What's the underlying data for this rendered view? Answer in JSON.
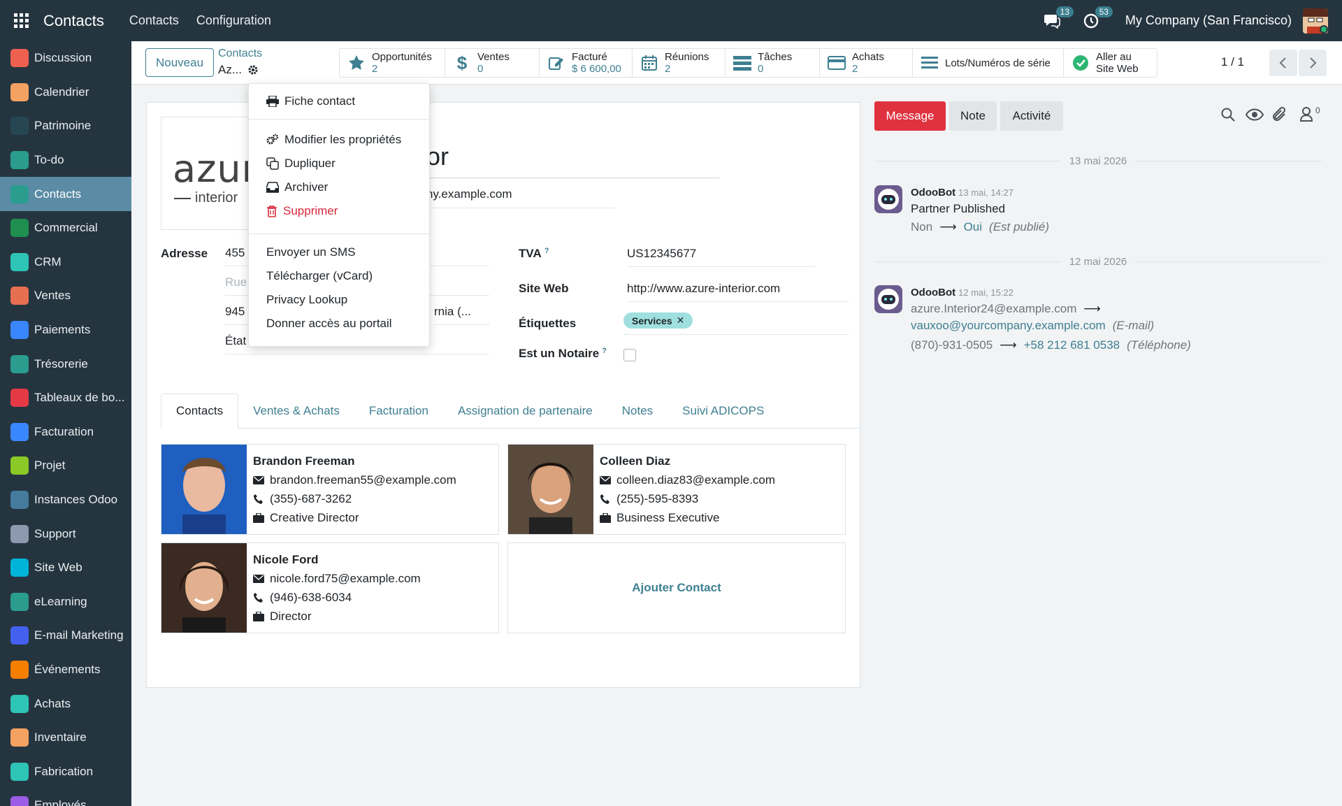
{
  "topbar": {
    "app_name": "Contacts",
    "menus": [
      "Contacts",
      "Configuration"
    ],
    "messages_count": "13",
    "activities_count": "53",
    "company": "My Company (San Francisco)"
  },
  "sidebar": {
    "items": [
      {
        "label": "Discussion",
        "icon": "discussion-icon",
        "color": "#f06050"
      },
      {
        "label": "Calendrier",
        "icon": "calendar-icon",
        "color": "#f4a261"
      },
      {
        "label": "Patrimoine",
        "icon": "assets-icon",
        "color": "#264653"
      },
      {
        "label": "To-do",
        "icon": "todo-icon",
        "color": "#2a9d8f"
      },
      {
        "label": "Contacts",
        "icon": "contacts-icon",
        "color": "#2a9d8f"
      },
      {
        "label": "Commercial",
        "icon": "commercial-icon",
        "color": "#1e8f4e"
      },
      {
        "label": "CRM",
        "icon": "crm-icon",
        "color": "#2ec4b6"
      },
      {
        "label": "Ventes",
        "icon": "sales-icon",
        "color": "#e76f51"
      },
      {
        "label": "Paiements",
        "icon": "payments-icon",
        "color": "#3a86ff"
      },
      {
        "label": "Trésorerie",
        "icon": "treasury-icon",
        "color": "#2a9d8f"
      },
      {
        "label": "Tableaux de bo...",
        "icon": "dashboards-icon",
        "color": "#e63946"
      },
      {
        "label": "Facturation",
        "icon": "invoicing-icon",
        "color": "#3a86ff"
      },
      {
        "label": "Projet",
        "icon": "project-icon",
        "color": "#8ac926"
      },
      {
        "label": "Instances Odoo",
        "icon": "instances-icon",
        "color": "#457b9d"
      },
      {
        "label": "Support",
        "icon": "support-icon",
        "color": "#8d99ae"
      },
      {
        "label": "Site Web",
        "icon": "website-icon",
        "color": "#00b4d8"
      },
      {
        "label": "eLearning",
        "icon": "elearning-icon",
        "color": "#2a9d8f"
      },
      {
        "label": "E-mail Marketing",
        "icon": "email-marketing-icon",
        "color": "#4361ee"
      },
      {
        "label": "Événements",
        "icon": "events-icon",
        "color": "#f77f00"
      },
      {
        "label": "Achats",
        "icon": "purchase-icon",
        "color": "#2ec4b6"
      },
      {
        "label": "Inventaire",
        "icon": "inventory-icon",
        "color": "#f4a261"
      },
      {
        "label": "Fabrication",
        "icon": "manufacturing-icon",
        "color": "#2ec4b6"
      },
      {
        "label": "Employés",
        "icon": "employees-icon",
        "color": "#9b5de5"
      }
    ]
  },
  "control": {
    "new_label": "Nouveau",
    "breadcrumb": "Contacts",
    "record_short": "Az...",
    "pager": "1 / 1"
  },
  "smart_buttons": [
    {
      "label": "Opportunités",
      "value": "2",
      "icon": "star-icon"
    },
    {
      "label": "Ventes",
      "value": "0",
      "icon": "dollar-icon"
    },
    {
      "label": "Facturé",
      "value": "$ 6 600,00",
      "icon": "edit-invoice-icon"
    },
    {
      "label": "Réunions",
      "value": "2",
      "icon": "calendar-icon"
    },
    {
      "label": "Tâches",
      "value": "0",
      "icon": "tasks-icon"
    },
    {
      "label": "Achats",
      "value": "2",
      "icon": "credit-card-icon"
    },
    {
      "label": "Lots/Numéros de série",
      "value": "",
      "icon": "list-icon"
    },
    {
      "label": "Aller au",
      "value": "Site Web",
      "icon": "globe-icon"
    }
  ],
  "dropdown": {
    "print": "Fiche contact",
    "edit_props": "Modifier les propriétés",
    "duplicate": "Dupliquer",
    "archive": "Archiver",
    "delete": "Supprimer",
    "sms": "Envoyer un SMS",
    "vcard": "Télécharger (vCard)",
    "privacy": "Privacy Lookup",
    "portal": "Donner accès au portail"
  },
  "form": {
    "name_partial": "or",
    "email_partial": "ny.example.com",
    "logo_text": "azure",
    "logo_sub": "interior",
    "address_label": "Adresse",
    "street_partial": "455",
    "street2_placeholder": "Rue",
    "zip_partial": "945",
    "state_partial": "rnia (...",
    "country_partial": "État",
    "vat_label": "TVA",
    "vat_value": "US12345677",
    "website_label": "Site Web",
    "website_value": "http://www.azure-interior.com",
    "tags_label": "Étiquettes",
    "tag": "Services",
    "notary_label": "Est un Notaire",
    "help_mark": "?"
  },
  "tabs": [
    "Contacts",
    "Ventes & Achats",
    "Facturation",
    "Assignation de partenaire",
    "Notes",
    "Suivi ADICOPS"
  ],
  "contacts": [
    {
      "name": "Brandon Freeman",
      "email": "brandon.freeman55@example.com",
      "phone": "(355)-687-3262",
      "job": "Creative Director"
    },
    {
      "name": "Colleen Diaz",
      "email": "colleen.diaz83@example.com",
      "phone": "(255)-595-8393",
      "job": "Business Executive"
    },
    {
      "name": "Nicole Ford",
      "email": "nicole.ford75@example.com",
      "phone": "(946)-638-6034",
      "job": "Director"
    }
  ],
  "add_contact": "Ajouter Contact",
  "chatter": {
    "message_btn": "Message",
    "note_btn": "Note",
    "activity_btn": "Activité",
    "followers_count": "0",
    "date1": "13 mai 2026",
    "date2": "12 mai 2026",
    "msg1": {
      "author": "OdooBot",
      "time": "13 mai, 14:27",
      "text": "Partner Published",
      "old": "Non",
      "new": "Oui",
      "field": "(Est publié)"
    },
    "msg2": {
      "author": "OdooBot",
      "time": "12 mai, 15:22",
      "old_email": "azure.Interior24@example.com",
      "new_email": "vauxoo@yourcompany.example.com",
      "email_field": "(E-mail)",
      "old_phone": "(870)-931-0505",
      "new_phone": "+58 212 681 0538",
      "phone_field": "(Téléphone)"
    }
  }
}
